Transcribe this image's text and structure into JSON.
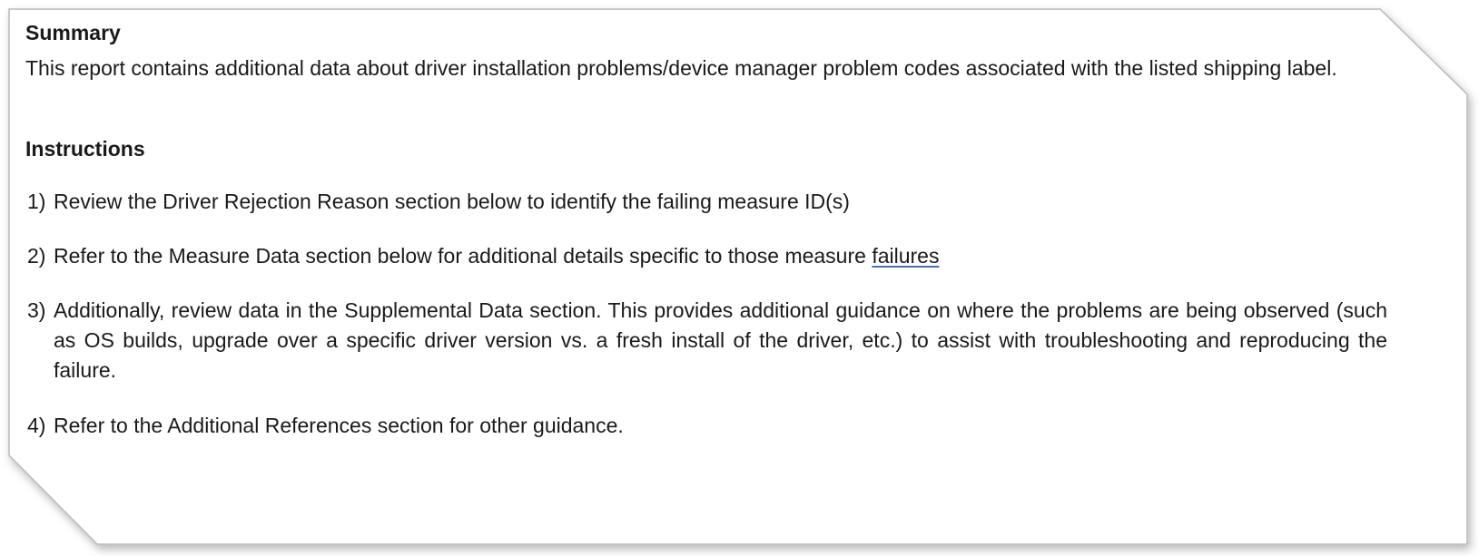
{
  "summary": {
    "heading": "Summary",
    "text": "This report contains additional data about driver installation problems/device manager problem codes associated with the listed shipping label."
  },
  "instructions": {
    "heading": "Instructions",
    "steps": [
      {
        "number": "1)",
        "text": "Review the Driver Rejection Reason section below to identify the failing measure ID(s)"
      },
      {
        "number": "2)",
        "text_before": "Refer to the Measure Data section below for additional details specific to those measure ",
        "link_text": "failures"
      },
      {
        "number": "3)",
        "text": "Additionally, review data in the Supplemental Data section. This provides additional guidance on where the problems are being observed (such as OS builds, upgrade over a specific driver version vs. a fresh install of the driver, etc.) to assist with troubleshooting and reproducing the failure."
      },
      {
        "number": "4)",
        "text": "Refer to the Additional References section for other guidance."
      }
    ]
  },
  "colors": {
    "frame_border": "#b9b9b9",
    "text": "#1a1a1a",
    "link_underline": "#4a6fb0"
  }
}
